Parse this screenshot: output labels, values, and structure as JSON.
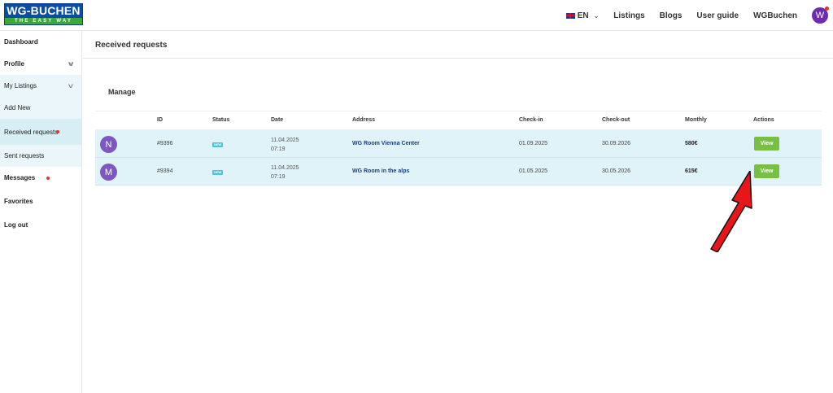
{
  "brand": {
    "logo_top": "WG-BUCHEN",
    "logo_bottom": "THE EASY WAY"
  },
  "nav": {
    "language": "EN",
    "links": [
      "Listings",
      "Blogs",
      "User guide",
      "WGBuchen"
    ],
    "avatar_initial": "W"
  },
  "sidebar": {
    "items": [
      {
        "label": "Dashboard"
      },
      {
        "label": "Profile"
      },
      {
        "label": "My Listings"
      },
      {
        "label": "Add New"
      },
      {
        "label": "Received requests"
      },
      {
        "label": "Sent requests"
      },
      {
        "label": "Messages"
      },
      {
        "label": "Favorites"
      },
      {
        "label": "Log out"
      }
    ]
  },
  "main": {
    "title": "Received requests",
    "section": "Manage",
    "columns": [
      "ID",
      "Status",
      "Date",
      "Address",
      "Check-in",
      "Check-out",
      "Monthly",
      "Actions"
    ],
    "rows": [
      {
        "initial": "N",
        "id": "#9396",
        "status": "NEW",
        "date": "11.04.2025",
        "time": "07:19",
        "address": "WG Room Vienna Center",
        "check_in": "01.09.2025",
        "check_out": "30.09.2026",
        "monthly": "580€",
        "action": "View"
      },
      {
        "initial": "M",
        "id": "#9394",
        "status": "NEW",
        "date": "11.04.2025",
        "time": "07:19",
        "address": "WG Room in the alps",
        "check_in": "01.05.2025",
        "check_out": "30.05.2026",
        "monthly": "615€",
        "action": "View"
      }
    ]
  },
  "colors": {
    "brand_blue": "#0a4ea3",
    "brand_green": "#3aa935",
    "row_bg": "#e0f3f8",
    "button_green": "#78c043",
    "badge_cyan": "#4ec2d9",
    "notification_red": "#e4322c",
    "avatar_purple": "#7e57c2",
    "arrow_red": "#e8161b"
  }
}
